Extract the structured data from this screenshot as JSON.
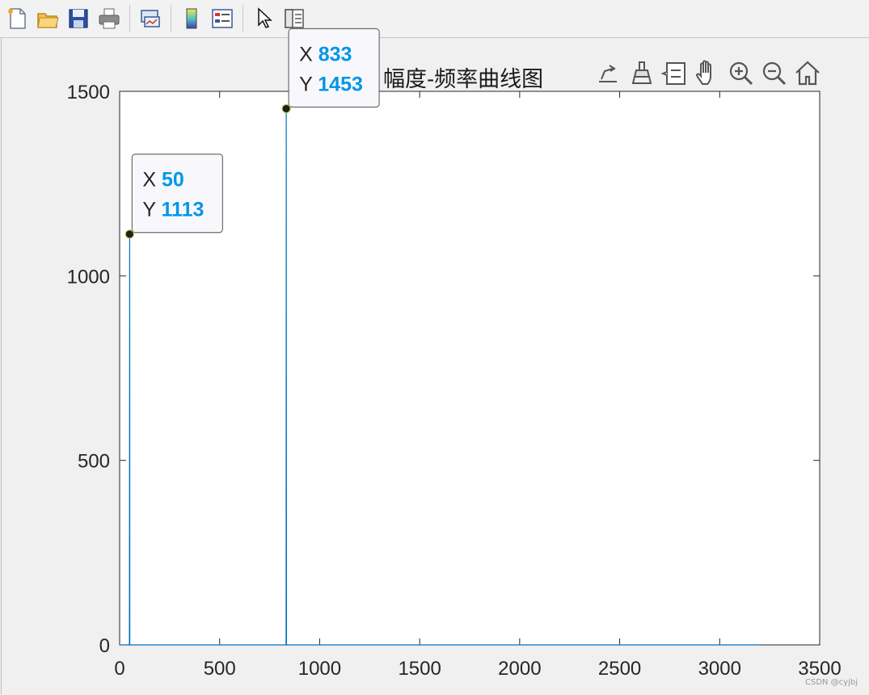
{
  "toolbar": {
    "buttons": [
      "new-figure-icon",
      "open-file-icon",
      "save-icon",
      "print-icon",
      "link-plot-icon",
      "colorbar-icon",
      "legend-icon",
      "pointer-icon",
      "property-inspector-icon"
    ]
  },
  "axes_toolbar": {
    "buttons": [
      "export-icon",
      "brush-icon",
      "data-tips-icon",
      "pan-icon",
      "zoom-in-icon",
      "zoom-out-icon",
      "home-icon"
    ]
  },
  "colors": {
    "line": "#0072bd",
    "datatip_value": "#0096e8",
    "background": "#f0f0f0"
  },
  "watermark": "CSDN @cyjbj",
  "chart_data": {
    "type": "line",
    "title": "幅度-频率曲线图",
    "xlabel": "",
    "ylabel": "",
    "xlim": [
      0,
      3500
    ],
    "ylim": [
      0,
      1500
    ],
    "xticks": [
      0,
      500,
      1000,
      1500,
      2000,
      2500,
      3000,
      3500
    ],
    "yticks": [
      0,
      500,
      1000,
      1500
    ],
    "x_end": 3200,
    "series": [
      {
        "x": [
          0,
          49,
          50,
          51,
          832,
          833,
          834,
          3200
        ],
        "y": [
          0,
          0,
          1113,
          0,
          0,
          1453,
          0,
          0
        ]
      }
    ],
    "datatips": [
      {
        "x_label": "X",
        "y_label": "Y",
        "x": 50,
        "y": 1113
      },
      {
        "x_label": "X",
        "y_label": "Y",
        "x": 833,
        "y": 1453
      }
    ]
  }
}
